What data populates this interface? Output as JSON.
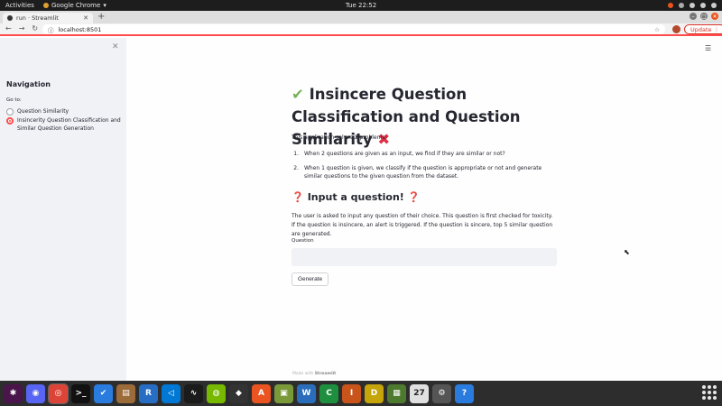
{
  "os_topbar": {
    "activities": "Activities",
    "app_name": "Google Chrome",
    "clock": "Tue 22:52"
  },
  "browser": {
    "tab_title": "run · Streamlit",
    "url": "localhost:8501",
    "update_label": "Update"
  },
  "sidebar": {
    "title": "Navigation",
    "goto_label": "Go to:",
    "options": [
      {
        "label": "Question Similarity",
        "selected": false
      },
      {
        "label": "Insincerity Question Classification and Similar Question Generation",
        "selected": true
      }
    ]
  },
  "main": {
    "title_emoji_start": "✔",
    "title_text": "Insincere Question Classification and Question Similarity",
    "title_emoji_end": "✖",
    "intro": "This application solves 2 problems:",
    "problems": [
      {
        "num": "1.",
        "text": "When 2 questions are given as an input, we find if they are similar or not?"
      },
      {
        "num": "2.",
        "text": "When 1 question is given, we classify if the question is appropriate or not and generate similar questions to the given question from the dataset."
      }
    ],
    "section_title": "Input a question!",
    "section_emoji": "❓",
    "description": "The user is asked to input any question of their choice. This question is first checked for toxicity. If the question is insincere, an alert is triggered. If the question is sincere, top 5 similar question are generated.",
    "question_label": "Question",
    "question_value": "",
    "generate_label": "Generate"
  },
  "footer": {
    "prefix": "Made with",
    "brand": "Streamlit"
  },
  "taskbar": {
    "apps": [
      {
        "name": "slack-icon",
        "glyph": "✱",
        "color": "#4a154b"
      },
      {
        "name": "discord-icon",
        "glyph": "◉",
        "color": "#5865f2"
      },
      {
        "name": "chrome-icon",
        "glyph": "◎",
        "color": "#db4437",
        "active": true
      },
      {
        "name": "terminal-icon",
        "glyph": ">_",
        "color": "#111111"
      },
      {
        "name": "tasks-icon",
        "glyph": "✔",
        "color": "#2a7bde"
      },
      {
        "name": "files-icon",
        "glyph": "▤",
        "color": "#9c6b3a"
      },
      {
        "name": "r-icon",
        "glyph": "R",
        "color": "#276dc3"
      },
      {
        "name": "vscode-icon",
        "glyph": "◁",
        "color": "#0078d4"
      },
      {
        "name": "system-monitor-icon",
        "glyph": "∿",
        "color": "#1b1b1b"
      },
      {
        "name": "nvidia-icon",
        "glyph": "◍",
        "color": "#76b900"
      },
      {
        "name": "inkscape-icon",
        "glyph": "◆",
        "color": "#333333"
      },
      {
        "name": "software-center-icon",
        "glyph": "A",
        "color": "#e95420"
      },
      {
        "name": "image-viewer-icon",
        "glyph": "▣",
        "color": "#7a9a3a"
      },
      {
        "name": "writer-icon",
        "glyph": "W",
        "color": "#2a6ebb"
      },
      {
        "name": "calc-icon",
        "glyph": "C",
        "color": "#1e8f3e"
      },
      {
        "name": "impress-icon",
        "glyph": "I",
        "color": "#c8541c"
      },
      {
        "name": "draw-icon",
        "glyph": "D",
        "color": "#c5a50a"
      },
      {
        "name": "calculator-icon",
        "glyph": "▦",
        "color": "#4d7a2e"
      },
      {
        "name": "calendar-icon",
        "glyph": "27",
        "color": "#e0e0e0"
      },
      {
        "name": "settings-icon",
        "glyph": "⚙",
        "color": "#555555"
      },
      {
        "name": "help-icon",
        "glyph": "?",
        "color": "#2a7bde"
      }
    ]
  }
}
